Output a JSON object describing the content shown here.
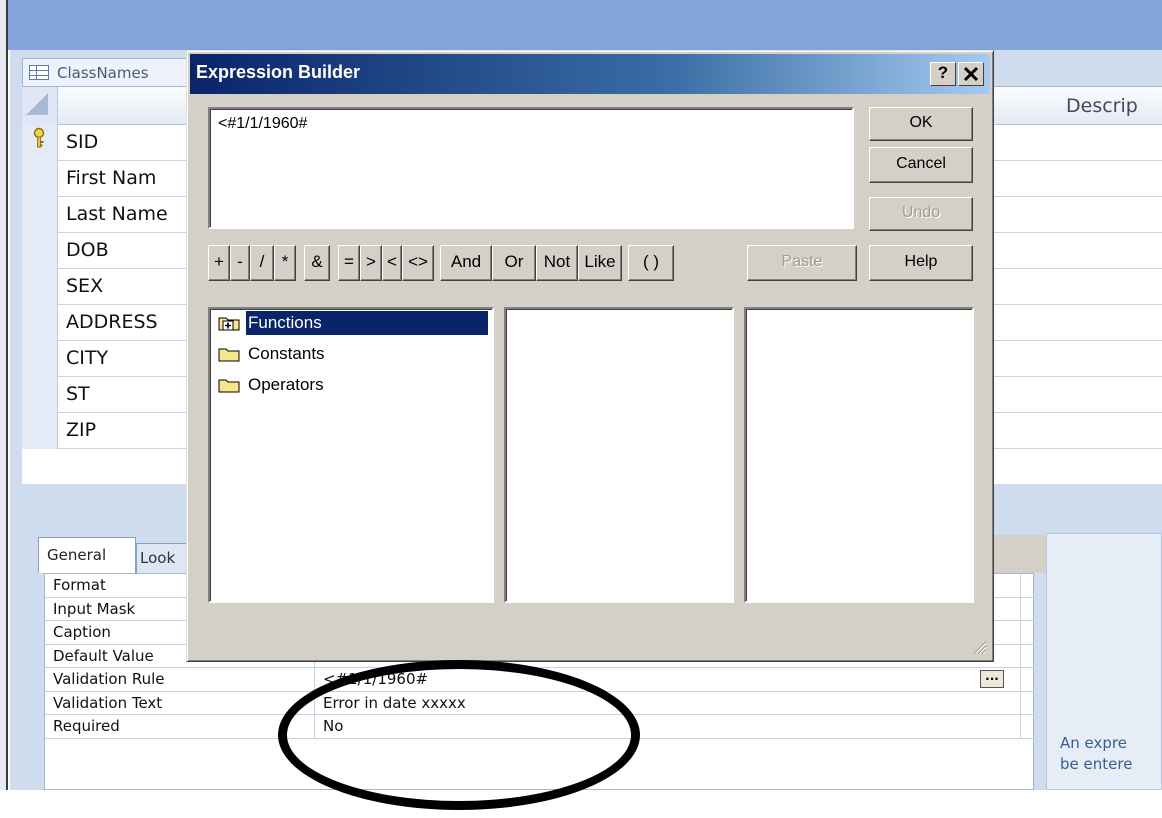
{
  "document": {
    "tab_title": "ClassNames",
    "description_header": "Descrip",
    "fields": [
      "SID",
      "First Nam",
      "Last Name",
      "DOB",
      "SEX",
      "ADDRESS",
      "CITY",
      "ST",
      "ZIP"
    ]
  },
  "property_tabs": {
    "general": "General",
    "lookup": "Look"
  },
  "properties": [
    {
      "label": "Format",
      "value": ""
    },
    {
      "label": "Input Mask",
      "value": ""
    },
    {
      "label": "Caption",
      "value": ""
    },
    {
      "label": "Default Value",
      "value": ""
    },
    {
      "label": "Validation Rule",
      "value": "<#1/1/1960#"
    },
    {
      "label": "Validation Text",
      "value": "Error in date xxxxx"
    },
    {
      "label": "Required",
      "value": "No"
    }
  ],
  "builder_button": "...",
  "help_text": {
    "line1": "An expre",
    "line2": "be entere"
  },
  "dialog": {
    "title": "Expression Builder",
    "help_button": "?",
    "close_button": "X",
    "expression": "<#1/1/1960#",
    "buttons": {
      "ok": "OK",
      "cancel": "Cancel",
      "undo": "Undo",
      "help": "Help",
      "paste": "Paste"
    },
    "operators": [
      "+",
      "-",
      "/",
      "*",
      "&",
      "=",
      ">",
      "<",
      "<>",
      "And",
      "Or",
      "Not",
      "Like",
      "( )"
    ],
    "tree": [
      {
        "label": "Functions",
        "expandable": true,
        "selected": true
      },
      {
        "label": "Constants",
        "expandable": false,
        "selected": false
      },
      {
        "label": "Operators",
        "expandable": false,
        "selected": false
      }
    ]
  },
  "colors": {
    "title_bar": "#0a246a",
    "selection": "#0a246a",
    "access_blue": "#82a4d8",
    "annotation": "#000000"
  }
}
